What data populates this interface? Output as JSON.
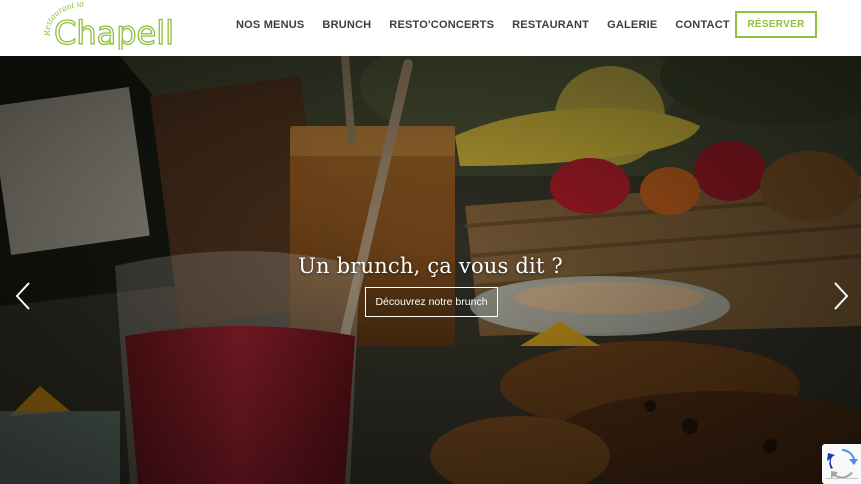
{
  "header": {
    "logo": {
      "small_text": "Restaurant la",
      "main_text": "Chapelle",
      "color": "#8fc13c"
    },
    "nav": [
      {
        "label": "NOS MENUS"
      },
      {
        "label": "BRUNCH"
      },
      {
        "label": "RESTO'CONCERTS"
      },
      {
        "label": "RESTAURANT"
      },
      {
        "label": "GALERIE"
      },
      {
        "label": "CONTACT"
      }
    ],
    "reserve_label": "RÉSERVER"
  },
  "hero": {
    "title": "Un brunch, ça vous dit ?",
    "cta_label": "Découvrez notre brunch",
    "prev_icon": "chevron-left-icon",
    "next_icon": "chevron-right-icon"
  },
  "recaptcha": {
    "icon": "recaptcha-icon"
  },
  "colors": {
    "accent": "#8fc13c",
    "nav_text": "#3d3d3d"
  }
}
